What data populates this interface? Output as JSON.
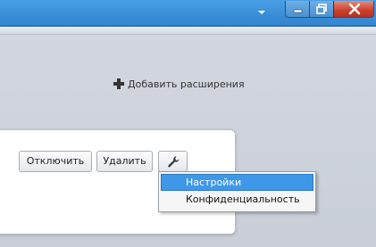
{
  "window": {
    "controls": {
      "minimize_icon": "minimize-icon",
      "maximize_icon": "restore-icon",
      "close_icon": "close-icon"
    },
    "accent_color": "#3a8fd8",
    "close_color": "#c8402e"
  },
  "addons": {
    "add_extensions_label": "Добавить расширения",
    "add_icon": "plus-icon"
  },
  "extension": {
    "disable_label": "Отключить",
    "remove_label": "Удалить",
    "tools_icon": "wrench-icon"
  },
  "menu": {
    "items": [
      {
        "label": "Настройки",
        "highlighted": true
      },
      {
        "label": "Конфиденциальность",
        "highlighted": false
      }
    ],
    "highlight_color": "#3f97e8"
  }
}
